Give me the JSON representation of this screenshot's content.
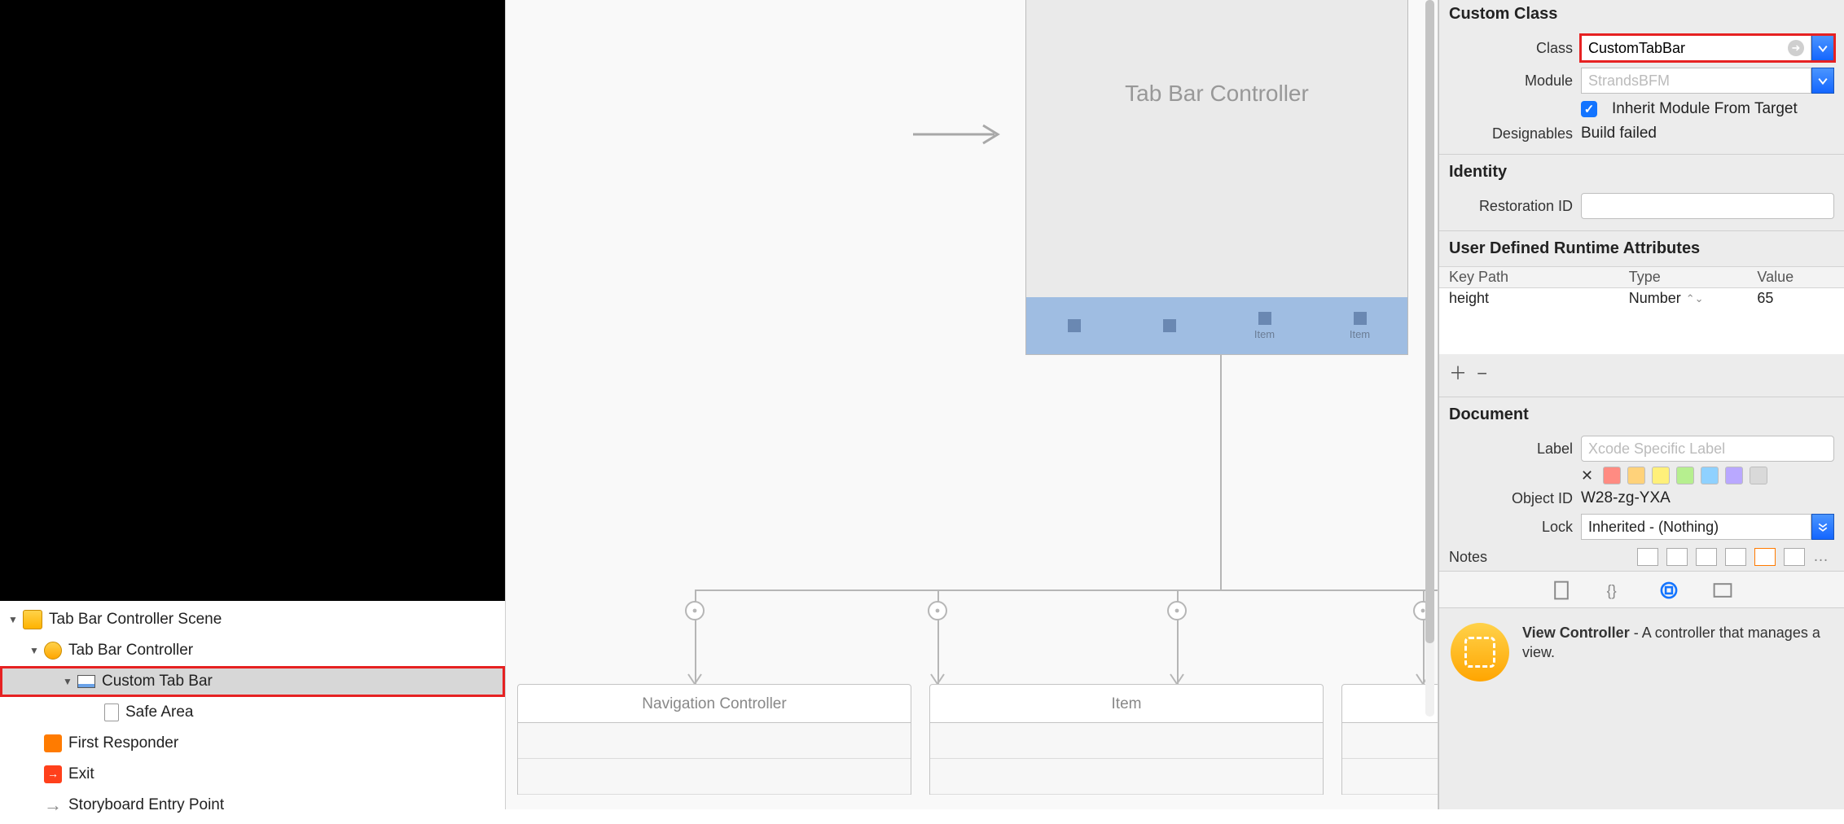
{
  "outline": {
    "scene": "Tab Bar Controller Scene",
    "vc": "Tab Bar Controller",
    "customTab": "Custom Tab Bar",
    "safeArea": "Safe Area",
    "firstResponder": "First Responder",
    "exit": "Exit",
    "entry": "Storyboard Entry Point"
  },
  "canvas": {
    "sceneTitle": "Tab Bar Controller",
    "tabItems": [
      "",
      "",
      "Item",
      "Item"
    ],
    "childScenes": [
      "Navigation Controller",
      "Item"
    ]
  },
  "inspector": {
    "customClass": {
      "header": "Custom Class",
      "classLabel": "Class",
      "classValue": "CustomTabBar",
      "moduleLabel": "Module",
      "modulePlaceholder": "StrandsBFM",
      "inheritLabel": "Inherit Module From Target",
      "designablesLabel": "Designables",
      "designablesValue": "Build failed"
    },
    "identity": {
      "header": "Identity",
      "restorationLabel": "Restoration ID",
      "restorationValue": ""
    },
    "runtimeAttrs": {
      "header": "User Defined Runtime Attributes",
      "cols": [
        "Key Path",
        "Type",
        "Value"
      ],
      "row": {
        "keyPath": "height",
        "type": "Number",
        "value": "65"
      }
    },
    "document": {
      "header": "Document",
      "labelLabel": "Label",
      "labelPlaceholder": "Xcode Specific Label",
      "objectIdLabel": "Object ID",
      "objectIdValue": "W28-zg-YXA",
      "lockLabel": "Lock",
      "lockValue": "Inherited - (Nothing)",
      "notesLabel": "Notes",
      "chipColors": [
        "#ff8b82",
        "#ffd27a",
        "#fff07a",
        "#b6ef8f",
        "#8fd1ff",
        "#b9a8ff",
        "#d9d9d9"
      ]
    },
    "library": {
      "itemTitle": "View Controller",
      "itemDesc": " - A controller that manages a view."
    }
  }
}
